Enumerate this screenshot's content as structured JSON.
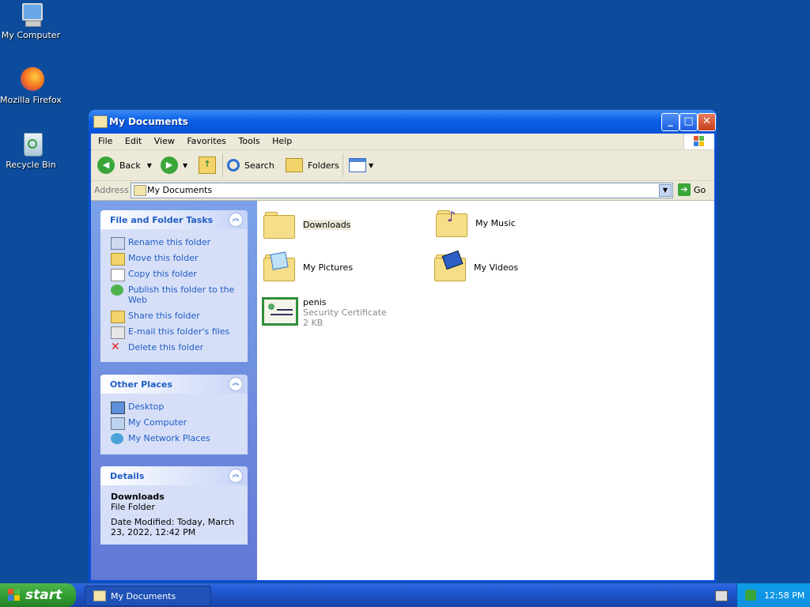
{
  "desktop": {
    "icons": [
      {
        "label": "My Computer",
        "icon": "my-computer-icon"
      },
      {
        "label": "Mozilla Firefox",
        "icon": "firefox-icon"
      },
      {
        "label": "Recycle Bin",
        "icon": "recycle-bin-icon"
      }
    ]
  },
  "window": {
    "title": "My Documents",
    "menu": [
      "File",
      "Edit",
      "View",
      "Favorites",
      "Tools",
      "Help"
    ],
    "toolbar": {
      "back": "Back",
      "search": "Search",
      "folders": "Folders"
    },
    "address": {
      "label": "Address",
      "value": "My Documents",
      "go": "Go"
    },
    "file_tasks": {
      "title": "File and Folder Tasks",
      "items": [
        "Rename this folder",
        "Move this folder",
        "Copy this folder",
        "Publish this folder to the Web",
        "Share this folder",
        "E-mail this folder's files",
        "Delete this folder"
      ]
    },
    "other_places": {
      "title": "Other Places",
      "items": [
        "Desktop",
        "My Computer",
        "My Network Places"
      ]
    },
    "details": {
      "title": "Details",
      "name": "Downloads",
      "type": "File Folder",
      "modified": "Date Modified: Today, March 23, 2022, 12:42 PM"
    },
    "files": [
      {
        "name": "Downloads",
        "kind": "folder"
      },
      {
        "name": "My Music",
        "kind": "music-folder"
      },
      {
        "name": "My Pictures",
        "kind": "pictures-folder"
      },
      {
        "name": "My Videos",
        "kind": "videos-folder"
      },
      {
        "name": "penis",
        "kind": "certificate",
        "type": "Security Certificate",
        "size": "2 KB"
      }
    ]
  },
  "taskbar": {
    "start": "start",
    "task_button": "My Documents",
    "clock": "12:58 PM"
  }
}
